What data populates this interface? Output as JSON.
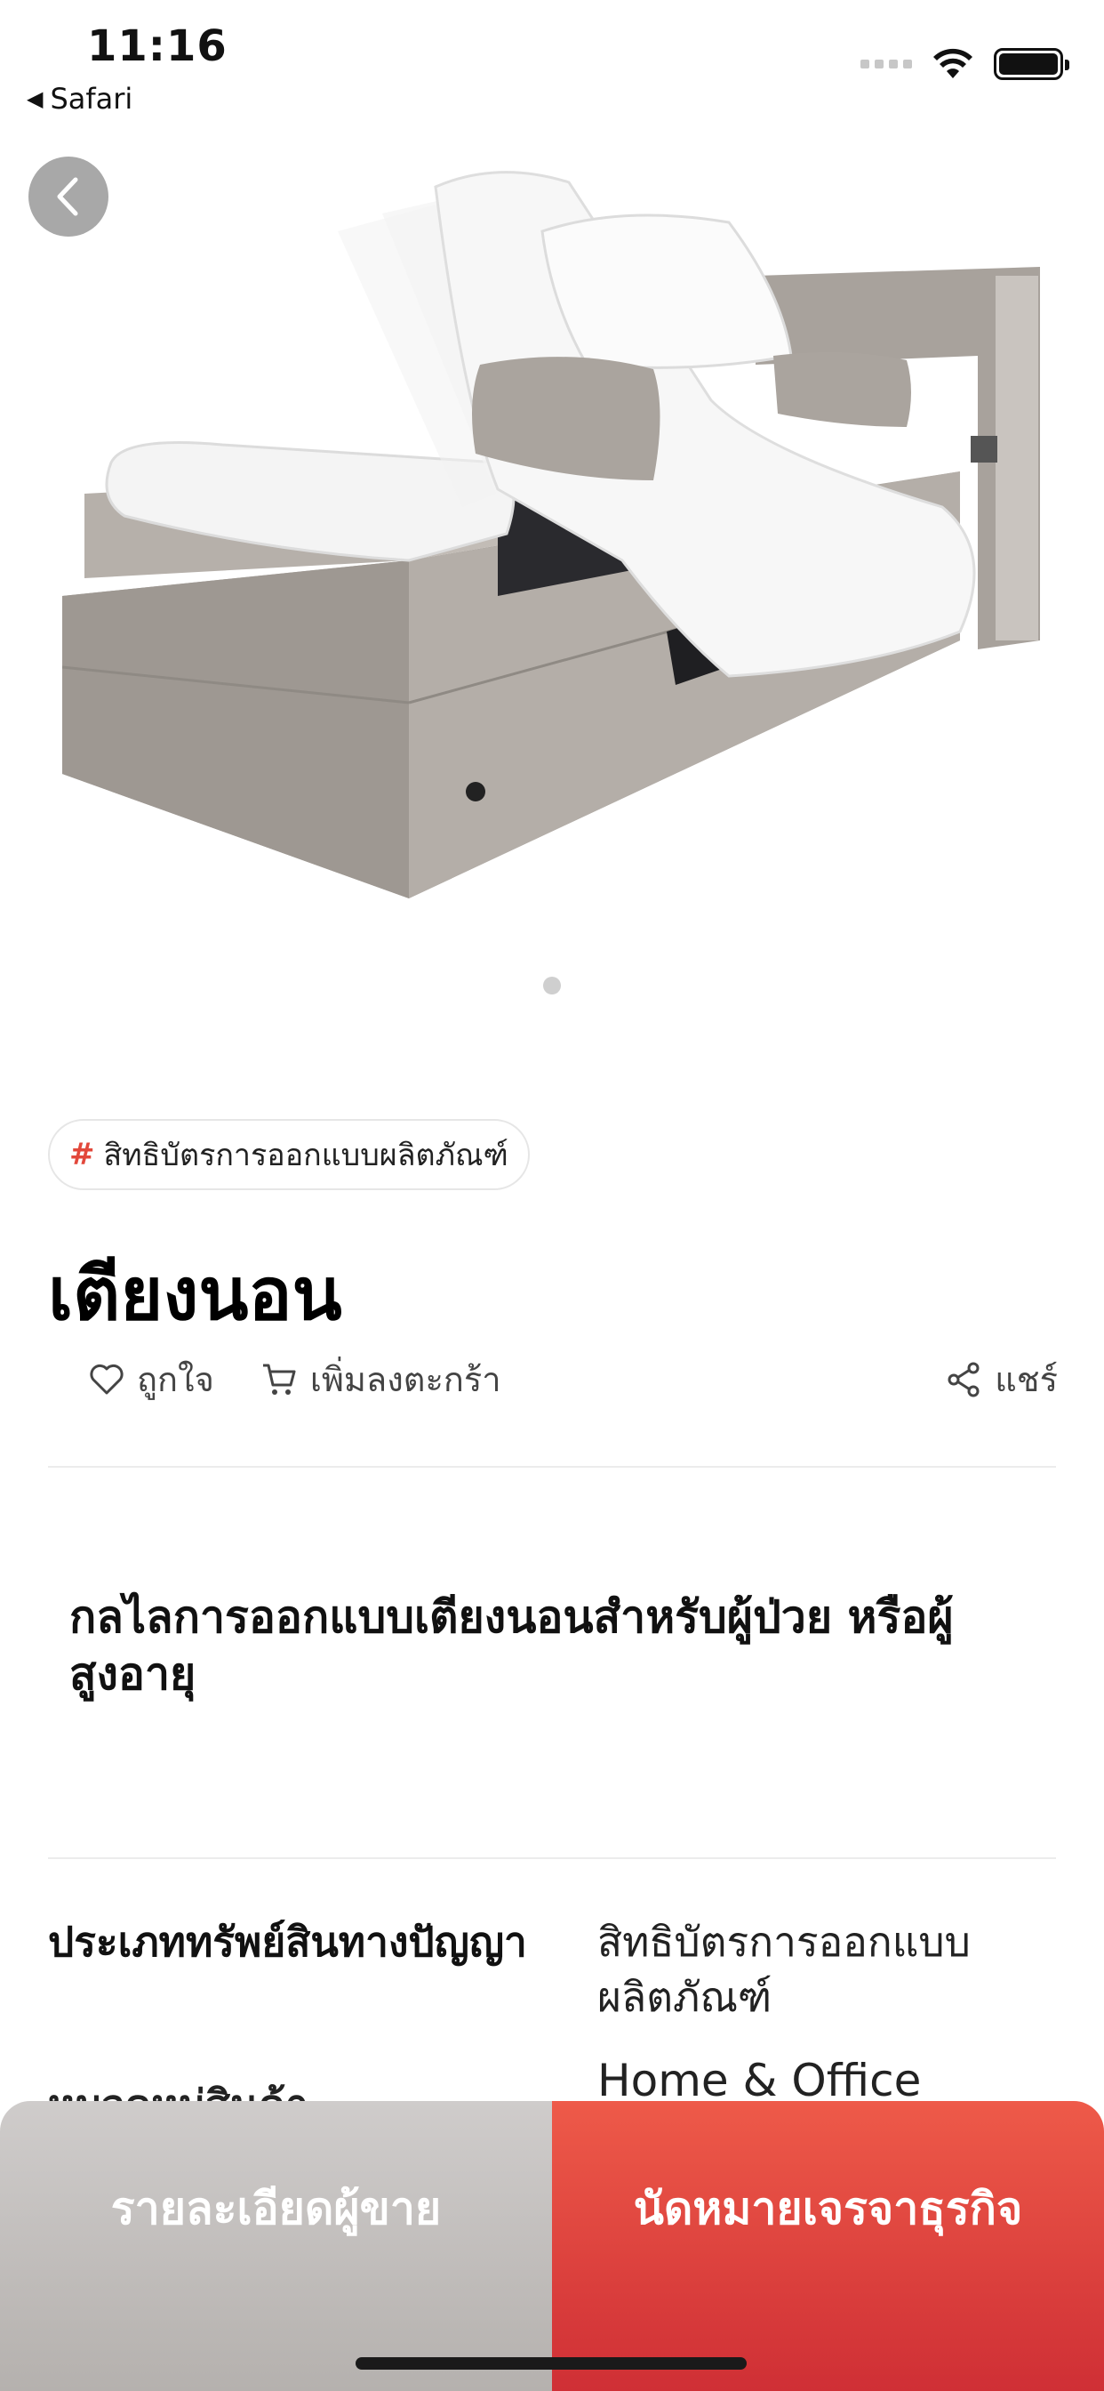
{
  "status_bar": {
    "time": "11:16",
    "back_app": "Safari"
  },
  "gallery": {
    "image_subject": "adjustable-care-bed-product-photo"
  },
  "product": {
    "tag": "สิทธิบัตรการออกแบบผลิตภัณฑ์",
    "title": "เตียงนอน",
    "like_label": "ถูกใจ",
    "cart_label": "เพิ่มลงตะกร้า",
    "share_label": "แชร์",
    "description": "กลไลการออกแบบเตียงนอนสำหรับผู้ป่วย หรือผู้สูงอายุ"
  },
  "details": {
    "ip_type_label": "ประเภททรัพย์สินทางปัญญา",
    "ip_type_value": "สิทธิบัตรการออกแบบผลิตภัณฑ์",
    "category_value": "Home & Office",
    "category_label": "หมวดหมู่สินค้า"
  },
  "bottom_bar": {
    "seller_button": "รายละเอียดผู้ขาย",
    "meeting_button": "นัดหมายเจรจาธุรกิจ"
  },
  "colors": {
    "accent": "#e2483b",
    "meeting_gradient_top": "#ee5a49",
    "meeting_gradient_bottom": "#cf2f35",
    "seller_gradient_top": "#cfcccb",
    "seller_gradient_bottom": "#b5b1ae"
  }
}
